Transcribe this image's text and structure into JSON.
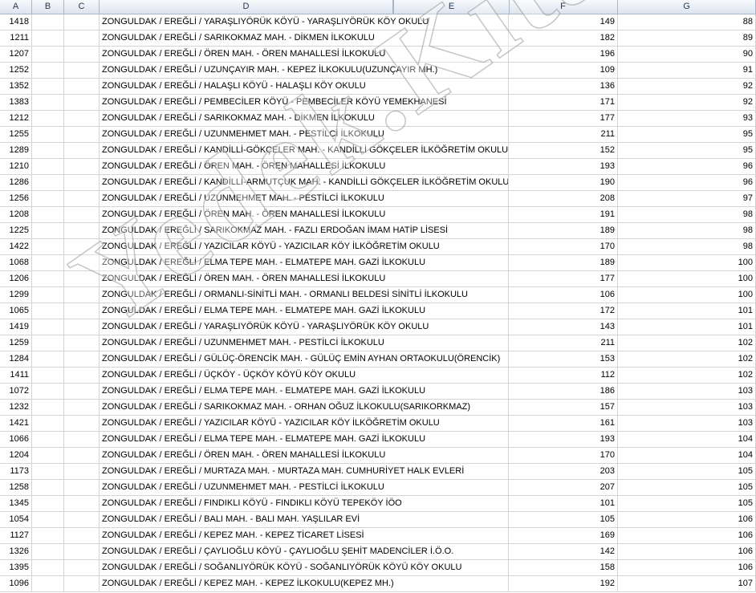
{
  "columns": [
    "A",
    "B",
    "C",
    "D",
    "E",
    "F",
    "G"
  ],
  "watermark": "Yedek.Kitap.Yuk",
  "rows": [
    {
      "a": "1418",
      "d": "ZONGULDAK / EREĞLİ / YARAŞLIYÖRÜK KÖYÜ - YARAŞLIYÖRÜK KÖY OKULU",
      "f": "149",
      "g": "88"
    },
    {
      "a": "1211",
      "d": "ZONGULDAK / EREĞLİ / SARIKOKMAZ MAH. - DİKMEN İLKOKULU",
      "f": "182",
      "g": "89"
    },
    {
      "a": "1207",
      "d": "ZONGULDAK / EREĞLİ / ÖREN MAH. - ÖREN MAHALLESİ İLKOKULU",
      "f": "196",
      "g": "90"
    },
    {
      "a": "1252",
      "d": "ZONGULDAK / EREĞLİ / UZUNÇAYIR MAH. - KEPEZ İLKOKULU(UZUNÇAYIR MH.)",
      "f": "109",
      "g": "91"
    },
    {
      "a": "1352",
      "d": "ZONGULDAK / EREĞLİ / HALAŞLI KÖYÜ - HALAŞLI KÖY OKULU",
      "f": "136",
      "g": "92"
    },
    {
      "a": "1383",
      "d": "ZONGULDAK / EREĞLİ / PEMBECİLER KÖYÜ - PEMBECİLER KÖYÜ YEMEKHANESİ",
      "f": "171",
      "g": "92"
    },
    {
      "a": "1212",
      "d": "ZONGULDAK / EREĞLİ / SARIKOKMAZ MAH. - DİKMEN İLKOKULU",
      "f": "177",
      "g": "93"
    },
    {
      "a": "1255",
      "d": "ZONGULDAK / EREĞLİ / UZUNMEHMET MAH. - PESTİLCİ İLKOKULU",
      "f": "211",
      "g": "95"
    },
    {
      "a": "1289",
      "d": "ZONGULDAK / EREĞLİ / KANDİLLİ-GÖKÇELER MAH. - KANDİLLİ GÖKÇELER İLKÖĞRETİM OKULU( GÖKÇ",
      "f": "152",
      "g": "95"
    },
    {
      "a": "1210",
      "d": "ZONGULDAK / EREĞLİ / ÖREN MAH. - ÖREN MAHALLESİ İLKOKULU",
      "f": "193",
      "g": "96"
    },
    {
      "a": "1286",
      "d": "ZONGULDAK / EREĞLİ / KANDİLLİ-ARMUTÇUK MAH. - KANDİLLİ GÖKÇELER İLKÖĞRETİM OKULU (ARMU",
      "f": "190",
      "g": "96"
    },
    {
      "a": "1256",
      "d": "ZONGULDAK / EREĞLİ / UZUNMEHMET MAH. - PESTİLCİ İLKOKULU",
      "f": "208",
      "g": "97"
    },
    {
      "a": "1208",
      "d": "ZONGULDAK / EREĞLİ / ÖREN MAH. - ÖREN MAHALLESİ İLKOKULU",
      "f": "191",
      "g": "98"
    },
    {
      "a": "1225",
      "d": "ZONGULDAK / EREĞLİ / SARIKOKMAZ MAH. - FAZLI ERDOĞAN İMAM HATİP LİSESİ",
      "f": "189",
      "g": "98"
    },
    {
      "a": "1422",
      "d": "ZONGULDAK / EREĞLİ / YAZICILAR KÖYÜ - YAZICILAR KÖY İLKÖĞRETİM OKULU",
      "f": "170",
      "g": "98"
    },
    {
      "a": "1068",
      "d": "ZONGULDAK / EREĞLİ / ELMA TEPE MAH. - ELMATEPE MAH. GAZİ İLKOKULU",
      "f": "189",
      "g": "100"
    },
    {
      "a": "1206",
      "d": "ZONGULDAK / EREĞLİ / ÖREN MAH. - ÖREN MAHALLESİ İLKOKULU",
      "f": "177",
      "g": "100"
    },
    {
      "a": "1299",
      "d": "ZONGULDAK / EREĞLİ / ORMANLI-SİNİTLİ MAH. - ORMANLI BELDESİ SİNİTLİ İLKOKULU",
      "f": "106",
      "g": "100"
    },
    {
      "a": "1065",
      "d": "ZONGULDAK / EREĞLİ / ELMA TEPE MAH. - ELMATEPE MAH. GAZİ İLKOKULU",
      "f": "172",
      "g": "101"
    },
    {
      "a": "1419",
      "d": "ZONGULDAK / EREĞLİ / YARAŞLIYÖRÜK KÖYÜ - YARAŞLIYÖRÜK KÖY OKULU",
      "f": "143",
      "g": "101"
    },
    {
      "a": "1259",
      "d": "ZONGULDAK / EREĞLİ / UZUNMEHMET MAH. - PESTİLCİ İLKOKULU",
      "f": "211",
      "g": "102"
    },
    {
      "a": "1284",
      "d": "ZONGULDAK / EREĞLİ / GÜLÜÇ-ÖRENCİK MAH. - GÜLÜÇ EMİN AYHAN ORTAOKULU(ÖRENCİK)",
      "f": "153",
      "g": "102"
    },
    {
      "a": "1411",
      "d": "ZONGULDAK / EREĞLİ / ÜÇKÖY - ÜÇKÖY KÖYÜ KÖY OKULU",
      "f": "112",
      "g": "102"
    },
    {
      "a": "1072",
      "d": "ZONGULDAK / EREĞLİ / ELMA TEPE MAH. - ELMATEPE MAH. GAZİ İLKOKULU",
      "f": "186",
      "g": "103"
    },
    {
      "a": "1232",
      "d": "ZONGULDAK / EREĞLİ / SARIKOKMAZ MAH. - ORHAN OĞUZ İLKOKULU(SARIKORKMAZ)",
      "f": "157",
      "g": "103"
    },
    {
      "a": "1421",
      "d": "ZONGULDAK / EREĞLİ / YAZICILAR KÖYÜ - YAZICILAR KÖY İLKÖĞRETİM OKULU",
      "f": "161",
      "g": "103"
    },
    {
      "a": "1066",
      "d": "ZONGULDAK / EREĞLİ / ELMA TEPE MAH. - ELMATEPE MAH. GAZİ İLKOKULU",
      "f": "193",
      "g": "104"
    },
    {
      "a": "1204",
      "d": "ZONGULDAK / EREĞLİ / ÖREN MAH. - ÖREN MAHALLESİ İLKOKULU",
      "f": "170",
      "g": "104"
    },
    {
      "a": "1173",
      "d": "ZONGULDAK / EREĞLİ / MURTAZA MAH. - MURTAZA MAH. CUMHURİYET HALK EVLERİ",
      "f": "203",
      "g": "105"
    },
    {
      "a": "1258",
      "d": "ZONGULDAK / EREĞLİ / UZUNMEHMET MAH. - PESTİLCİ İLKOKULU",
      "f": "207",
      "g": "105"
    },
    {
      "a": "1345",
      "d": "ZONGULDAK / EREĞLİ / FINDIKLI KÖYÜ - FINDIKLI KÖYÜ TEPEKÖY İÖO",
      "f": "101",
      "g": "105"
    },
    {
      "a": "1054",
      "d": "ZONGULDAK / EREĞLİ / BALI MAH. - BALI MAH. YAŞLILAR EVİ",
      "f": "105",
      "g": "106"
    },
    {
      "a": "1127",
      "d": "ZONGULDAK / EREĞLİ / KEPEZ MAH. - KEPEZ TİCARET LİSESİ",
      "f": "169",
      "g": "106"
    },
    {
      "a": "1326",
      "d": "ZONGULDAK / EREĞLİ / ÇAYLIOĞLU KÖYÜ - ÇAYLIOĞLU ŞEHİT MADENCİLER İ.Ö.O.",
      "f": "142",
      "g": "106"
    },
    {
      "a": "1395",
      "d": "ZONGULDAK / EREĞLİ / SOĞANLIYÖRÜK KÖYÜ - SOĞANLIYÖRÜK KÖYÜ KÖY OKULU",
      "f": "158",
      "g": "106"
    },
    {
      "a": "1096",
      "d": "ZONGULDAK / EREĞLİ / KEPEZ MAH. - KEPEZ İLKOKULU(KEPEZ MH.)",
      "f": "192",
      "g": "107"
    }
  ]
}
